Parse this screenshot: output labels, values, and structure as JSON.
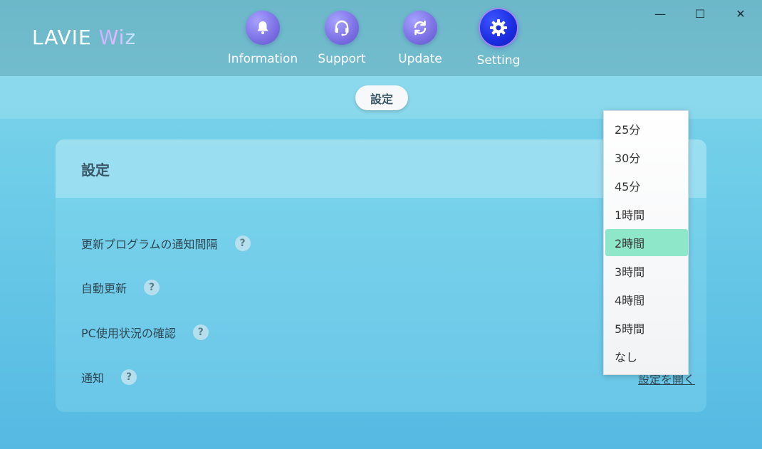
{
  "app": {
    "logo_main": "LAVIE ",
    "logo_accent": "Wiz"
  },
  "nav": [
    {
      "label": "Information",
      "icon": "bell-icon"
    },
    {
      "label": "Support",
      "icon": "headset-icon"
    },
    {
      "label": "Update",
      "icon": "refresh-icon"
    },
    {
      "label": "Setting",
      "icon": "gear-icon",
      "active": true
    }
  ],
  "window_controls": {
    "minimize": "—",
    "maximize": "☐",
    "close": "✕"
  },
  "sub_tab": "設定",
  "card": {
    "title": "設定",
    "rows": [
      {
        "label": "更新プログラムの通知間隔",
        "help": "?"
      },
      {
        "label": "自動更新",
        "help": "?"
      },
      {
        "label": "PC使用状況の確認",
        "help": "?"
      },
      {
        "label": "通知",
        "help": "?"
      }
    ],
    "notification_link": "設定を開く"
  },
  "dropdown": {
    "options": [
      "25分",
      "30分",
      "45分",
      "1時間",
      "2時間",
      "3時間",
      "4時間",
      "5時間",
      "なし"
    ],
    "selected": "2時間",
    "selected_color": "#8de7c8"
  }
}
